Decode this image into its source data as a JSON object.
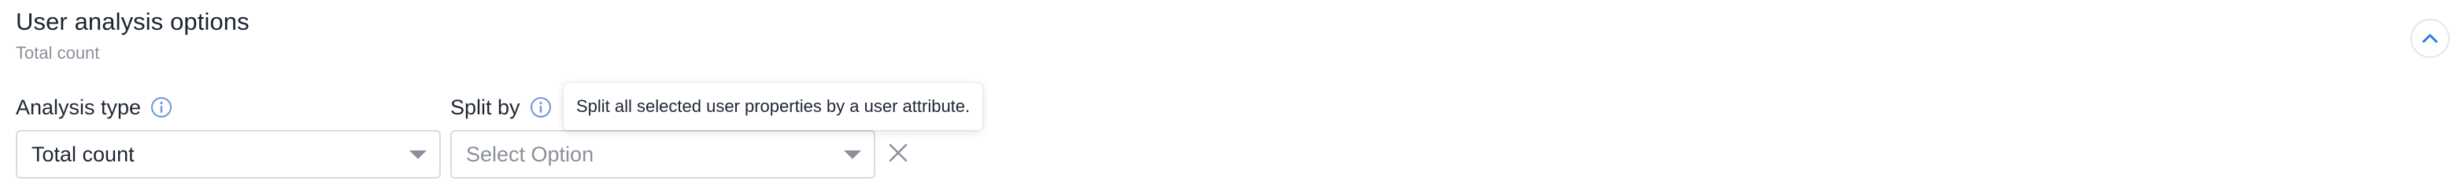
{
  "section": {
    "title": "User analysis options",
    "subtitle": "Total count"
  },
  "analysis_type": {
    "label": "Analysis type",
    "value": "Total count"
  },
  "split_by": {
    "label": "Split by",
    "placeholder": "Select Option",
    "tooltip": "Split all selected user properties by a user attribute."
  },
  "icons": {
    "collapse": "chevron-up-icon",
    "info": "info-icon",
    "clear": "close-icon",
    "caret": "caret-down-icon"
  },
  "colors": {
    "accent": "#2a7de1",
    "icon_muted": "#8a9099",
    "info_icon": "#6f97d6",
    "border": "#d7dbe0"
  }
}
